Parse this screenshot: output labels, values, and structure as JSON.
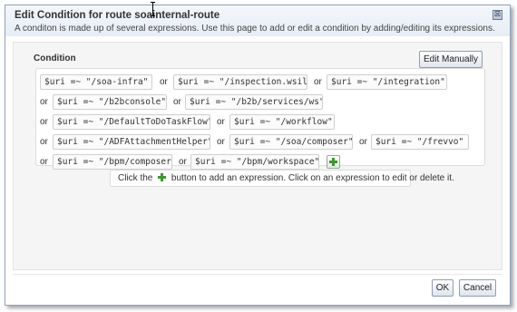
{
  "dialog": {
    "title": "Edit Condition for route soainternal-route",
    "subtitle": "A conditon is made up of several expressions. Use this page to add or edit a condition by adding/editing its expressions.",
    "close_glyph": "⊠"
  },
  "condition": {
    "label": "Condition",
    "edit_manually_label": "Edit Manually",
    "or_label": "or",
    "rows": [
      [
        "$uri =~ \"/soa-infra\"",
        "$uri =~ \"/inspection.wsil\"",
        "$uri =~ \"/integration\""
      ],
      [
        "$uri =~ \"/b2bconsole\"",
        "$uri =~ \"/b2b/services/ws\""
      ],
      [
        "$uri =~ \"/DefaultToDoTaskFlow\"",
        "$uri =~ \"/workflow\""
      ],
      [
        "$uri =~ \"/ADFAttachmentHelper\"",
        "$uri =~ \"/soa/composer\"",
        "$uri =~ \"/frevvo\""
      ],
      [
        "$uri =~ \"/bpm/composer\"",
        "$uri =~ \"/bpm/workspace\""
      ]
    ]
  },
  "hint": {
    "before": "Click the",
    "after": "button to add an expression. Click on an expression to edit or delete it."
  },
  "footer": {
    "ok_label": "OK",
    "cancel_label": "Cancel"
  },
  "icons": {
    "add": "add-expression-icon",
    "close": "close-icon"
  },
  "colors": {
    "plus_green": "#3a9a2a",
    "title_gradient_top": "#f4f7fb"
  }
}
